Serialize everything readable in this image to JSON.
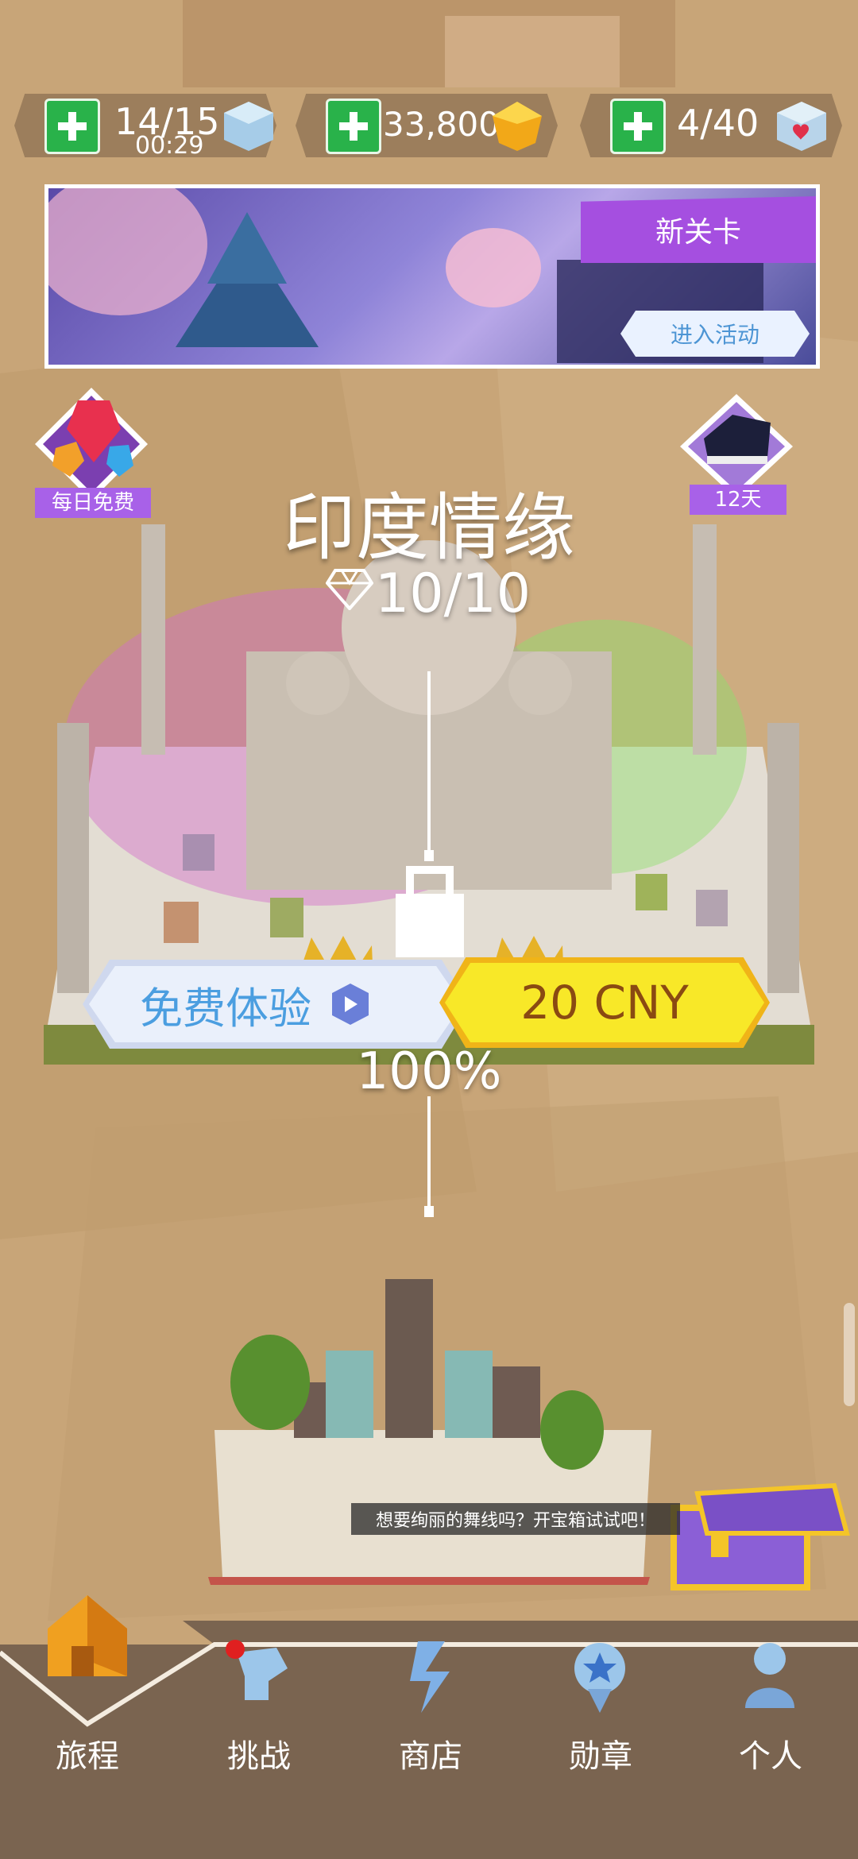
{
  "resources": [
    {
      "value": "14/15",
      "sub": "00:29",
      "icon": "ice-cube-icon"
    },
    {
      "value": "33,800",
      "icon": "gold-gem-icon"
    },
    {
      "value": "4/40",
      "icon": "heart-cube-icon"
    }
  ],
  "banner": {
    "ribbon": "新关卡",
    "button": "进入活动"
  },
  "daily_free": "每日免费",
  "piano_days": "12天",
  "level": {
    "title": "印度情缘",
    "diamonds": "10/10",
    "percent": "100%"
  },
  "actions": {
    "free_trial": "免费体验",
    "buy": "20 CNY"
  },
  "tip": "想要绚丽的舞线吗？开宝箱试试吧！",
  "nav": [
    {
      "label": "旅程",
      "icon": "house-icon"
    },
    {
      "label": "挑战",
      "icon": "challenge-icon"
    },
    {
      "label": "商店",
      "icon": "shop-icon"
    },
    {
      "label": "勋章",
      "icon": "medal-icon"
    },
    {
      "label": "个人",
      "icon": "profile-icon"
    }
  ],
  "colors": {
    "accent_purple": "#a54fe0",
    "buy_yellow": "#f8e828",
    "plus_green": "#29b24a"
  }
}
